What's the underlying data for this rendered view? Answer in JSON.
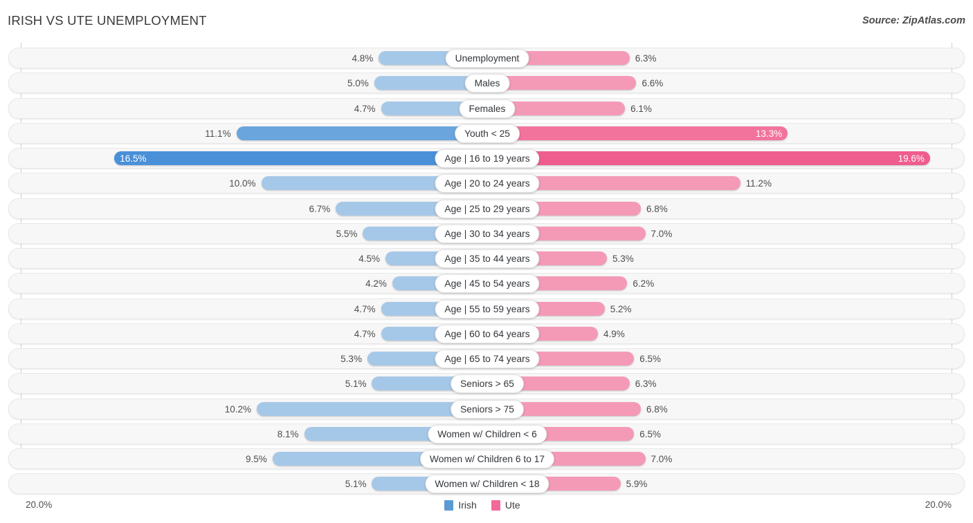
{
  "header": {
    "title": "IRISH VS UTE UNEMPLOYMENT",
    "source": "Source: ZipAtlas.com"
  },
  "footer": {
    "axis_left": "20.0%",
    "axis_right": "20.0%",
    "legend": [
      {
        "label": "Irish",
        "color": "#5b9bd5"
      },
      {
        "label": "Ute",
        "color": "#f2689b"
      }
    ]
  },
  "chart_data": {
    "type": "bar",
    "title": "IRISH VS UTE UNEMPLOYMENT",
    "subtitle": "Source: ZipAtlas.com",
    "orientation": "horizontal-diverging",
    "xlabel": "",
    "ylabel": "",
    "xlim": [
      0,
      20
    ],
    "axis_max": 20.0,
    "axis_max_label": "20.0%",
    "grid": false,
    "legend_position": "bottom-center",
    "categories": [
      "Unemployment",
      "Males",
      "Females",
      "Youth < 25",
      "Age | 16 to 19 years",
      "Age | 20 to 24 years",
      "Age | 25 to 29 years",
      "Age | 30 to 34 years",
      "Age | 35 to 44 years",
      "Age | 45 to 54 years",
      "Age | 55 to 59 years",
      "Age | 60 to 64 years",
      "Age | 65 to 74 years",
      "Seniors > 65",
      "Seniors > 75",
      "Women w/ Children < 6",
      "Women w/ Children 6 to 17",
      "Women w/ Children < 18"
    ],
    "series": [
      {
        "name": "Irish",
        "color": "#5b9bd5",
        "side": "left",
        "values": [
          4.8,
          5.0,
          4.7,
          11.1,
          16.5,
          10.0,
          6.7,
          5.5,
          4.5,
          4.2,
          4.7,
          4.7,
          5.3,
          5.1,
          10.2,
          8.1,
          9.5,
          5.1
        ],
        "labels": [
          "4.8%",
          "5.0%",
          "4.7%",
          "11.1%",
          "16.5%",
          "10.0%",
          "6.7%",
          "5.5%",
          "4.5%",
          "4.2%",
          "4.7%",
          "4.7%",
          "5.3%",
          "5.1%",
          "10.2%",
          "8.1%",
          "9.5%",
          "5.1%"
        ]
      },
      {
        "name": "Ute",
        "color": "#f2689b",
        "side": "right",
        "values": [
          6.3,
          6.6,
          6.1,
          13.3,
          19.6,
          11.2,
          6.8,
          7.0,
          5.3,
          6.2,
          5.2,
          4.9,
          6.5,
          6.3,
          6.8,
          6.5,
          7.0,
          5.9
        ],
        "labels": [
          "6.3%",
          "6.6%",
          "6.1%",
          "13.3%",
          "19.6%",
          "11.2%",
          "6.8%",
          "7.0%",
          "5.3%",
          "6.2%",
          "5.2%",
          "4.9%",
          "6.5%",
          "6.3%",
          "6.8%",
          "6.5%",
          "7.0%",
          "5.9%"
        ]
      }
    ]
  },
  "rows": [
    {
      "label": "Unemployment",
      "left": 4.8,
      "left_label": "4.8%",
      "right": 6.3,
      "right_label": "6.3%",
      "emphasis": 0
    },
    {
      "label": "Males",
      "left": 5.0,
      "left_label": "5.0%",
      "right": 6.6,
      "right_label": "6.6%",
      "emphasis": 0
    },
    {
      "label": "Females",
      "left": 4.7,
      "left_label": "4.7%",
      "right": 6.1,
      "right_label": "6.1%",
      "emphasis": 0
    },
    {
      "label": "Youth < 25",
      "left": 11.1,
      "left_label": "11.1%",
      "right": 13.3,
      "right_label": "13.3%",
      "emphasis": 1
    },
    {
      "label": "Age | 16 to 19 years",
      "left": 16.5,
      "left_label": "16.5%",
      "right": 19.6,
      "right_label": "19.6%",
      "emphasis": 2
    },
    {
      "label": "Age | 20 to 24 years",
      "left": 10.0,
      "left_label": "10.0%",
      "right": 11.2,
      "right_label": "11.2%",
      "emphasis": 0
    },
    {
      "label": "Age | 25 to 29 years",
      "left": 6.7,
      "left_label": "6.7%",
      "right": 6.8,
      "right_label": "6.8%",
      "emphasis": 0
    },
    {
      "label": "Age | 30 to 34 years",
      "left": 5.5,
      "left_label": "5.5%",
      "right": 7.0,
      "right_label": "7.0%",
      "emphasis": 0
    },
    {
      "label": "Age | 35 to 44 years",
      "left": 4.5,
      "left_label": "4.5%",
      "right": 5.3,
      "right_label": "5.3%",
      "emphasis": 0
    },
    {
      "label": "Age | 45 to 54 years",
      "left": 4.2,
      "left_label": "4.2%",
      "right": 6.2,
      "right_label": "6.2%",
      "emphasis": 0
    },
    {
      "label": "Age | 55 to 59 years",
      "left": 4.7,
      "left_label": "4.7%",
      "right": 5.2,
      "right_label": "5.2%",
      "emphasis": 0
    },
    {
      "label": "Age | 60 to 64 years",
      "left": 4.7,
      "left_label": "4.7%",
      "right": 4.9,
      "right_label": "4.9%",
      "emphasis": 0
    },
    {
      "label": "Age | 65 to 74 years",
      "left": 5.3,
      "left_label": "5.3%",
      "right": 6.5,
      "right_label": "6.5%",
      "emphasis": 0
    },
    {
      "label": "Seniors > 65",
      "left": 5.1,
      "left_label": "5.1%",
      "right": 6.3,
      "right_label": "6.3%",
      "emphasis": 0
    },
    {
      "label": "Seniors > 75",
      "left": 10.2,
      "left_label": "10.2%",
      "right": 6.8,
      "right_label": "6.8%",
      "emphasis": 0
    },
    {
      "label": "Women w/ Children < 6",
      "left": 8.1,
      "left_label": "8.1%",
      "right": 6.5,
      "right_label": "6.5%",
      "emphasis": 0
    },
    {
      "label": "Women w/ Children 6 to 17",
      "left": 9.5,
      "left_label": "9.5%",
      "right": 7.0,
      "right_label": "7.0%",
      "emphasis": 0
    },
    {
      "label": "Women w/ Children < 18",
      "left": 5.1,
      "left_label": "5.1%",
      "right": 5.9,
      "right_label": "5.9%",
      "emphasis": 0
    }
  ]
}
